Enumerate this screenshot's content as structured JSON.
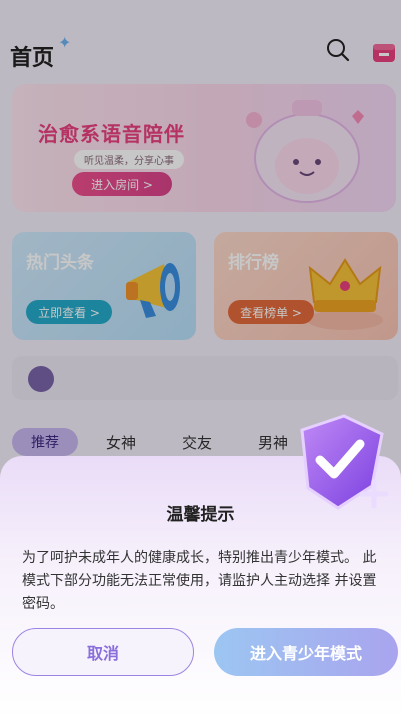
{
  "header": {
    "title": "首页"
  },
  "banner": {
    "title": "治愈系语音陪伴",
    "subtitle": "听见温柔，分享心事",
    "button": "进入房间 >"
  },
  "cards": [
    {
      "title": "热门头条",
      "button": "立即查看 >"
    },
    {
      "title": "排行榜",
      "button": "查看榜单 >"
    }
  ],
  "tabs": [
    "推荐",
    "女神",
    "交友",
    "男神"
  ],
  "dialog": {
    "title": "温馨提示",
    "body": "为了呵护未成年人的健康成长，特别推出青少年模式。 此模式下部分功能无法正常使用，请监护人主动选择 并设置密码。",
    "cancel": "取消",
    "confirm": "进入青少年模式"
  },
  "colors": {
    "accent": "#8a6fdc",
    "pink": "#e8407e"
  }
}
